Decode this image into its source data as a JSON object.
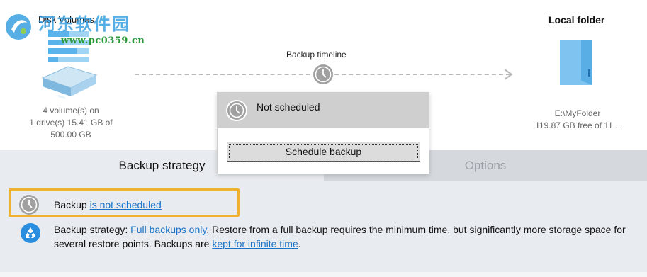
{
  "watermark": {
    "text": "河东软件园",
    "url": "www.pc0359.cn"
  },
  "source": {
    "title": "Disk Volumes",
    "info_lines": [
      "4 volume(s) on",
      "1 drive(s) 15.41 GB of",
      "500.00 GB"
    ]
  },
  "destination": {
    "title": "Local folder",
    "path": "E:\\MyFolder",
    "free": "119.87 GB free of 11..."
  },
  "timeline": {
    "label": "Backup timeline"
  },
  "popup": {
    "title": "Not scheduled",
    "button_label": "Schedule backup"
  },
  "tabs": [
    {
      "label": "Backup strategy"
    },
    {
      "label": "Options"
    }
  ],
  "schedule_row": {
    "prefix": "Backup ",
    "link": "is not scheduled"
  },
  "strategy_row": {
    "prefix": "Backup strategy: ",
    "link1": "Full backups only",
    "middle": ". Restore from a full backup requires the minimum time, but significantly more storage space for several restore points. Backups are ",
    "link2": "kept for infinite time",
    "suffix": "."
  },
  "colors": {
    "accent_link": "#1a73c8",
    "highlight": "#f0b030",
    "folder": "#7fc4f0",
    "strategy_icon": "#2a8ee0"
  }
}
